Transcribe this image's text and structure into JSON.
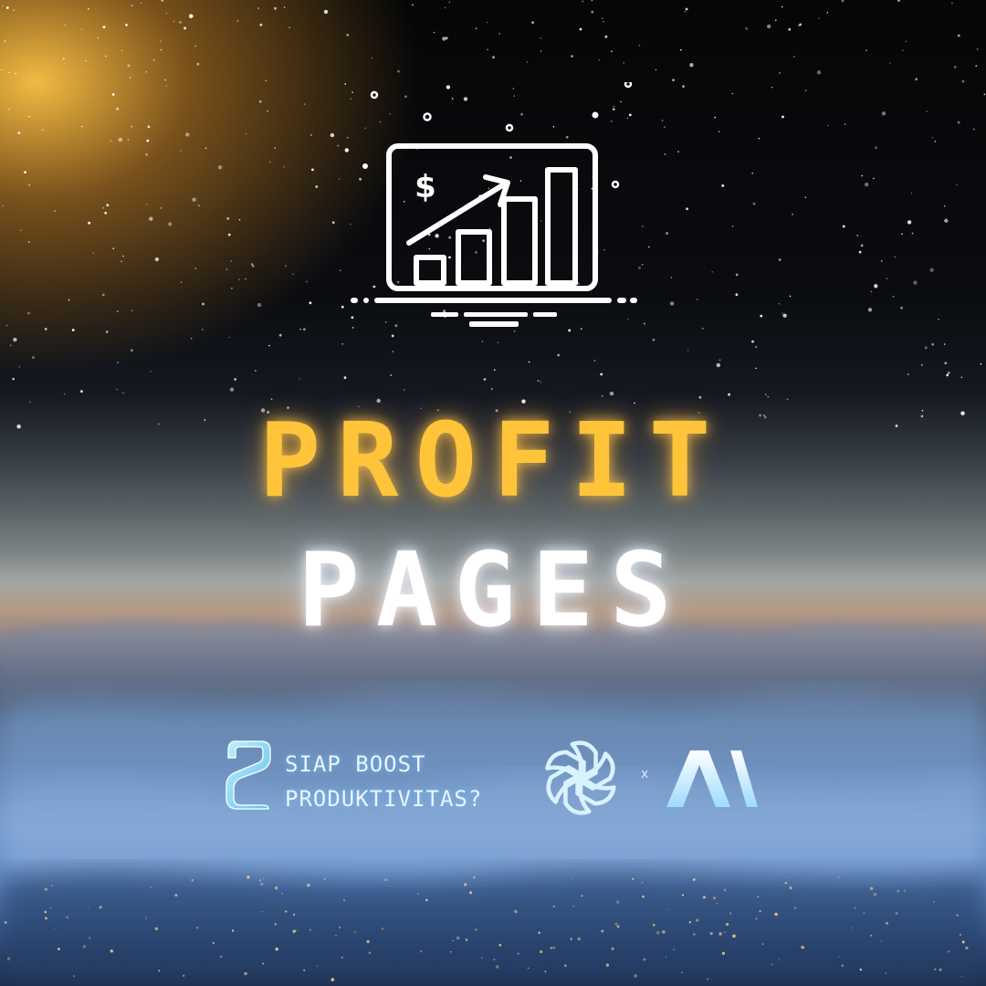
{
  "title": {
    "line1": "PROFIT",
    "line2": "PAGES"
  },
  "tagline": {
    "line1": "SIAP BOOST",
    "line2": "PRODUKTIVITAS?"
  },
  "icon": {
    "name": "monitor-growth-chart-icon",
    "currency_symbol": "$"
  },
  "logos": {
    "left": "e-logo-icon",
    "openai": "openai-logo-icon",
    "separator": "x",
    "ai": "AI"
  },
  "colors": {
    "title_line1": "#ffc43a",
    "title_line2": "#ffffff",
    "tagline": "#eaf4ff",
    "logo_glow": "#7fd3ff"
  }
}
